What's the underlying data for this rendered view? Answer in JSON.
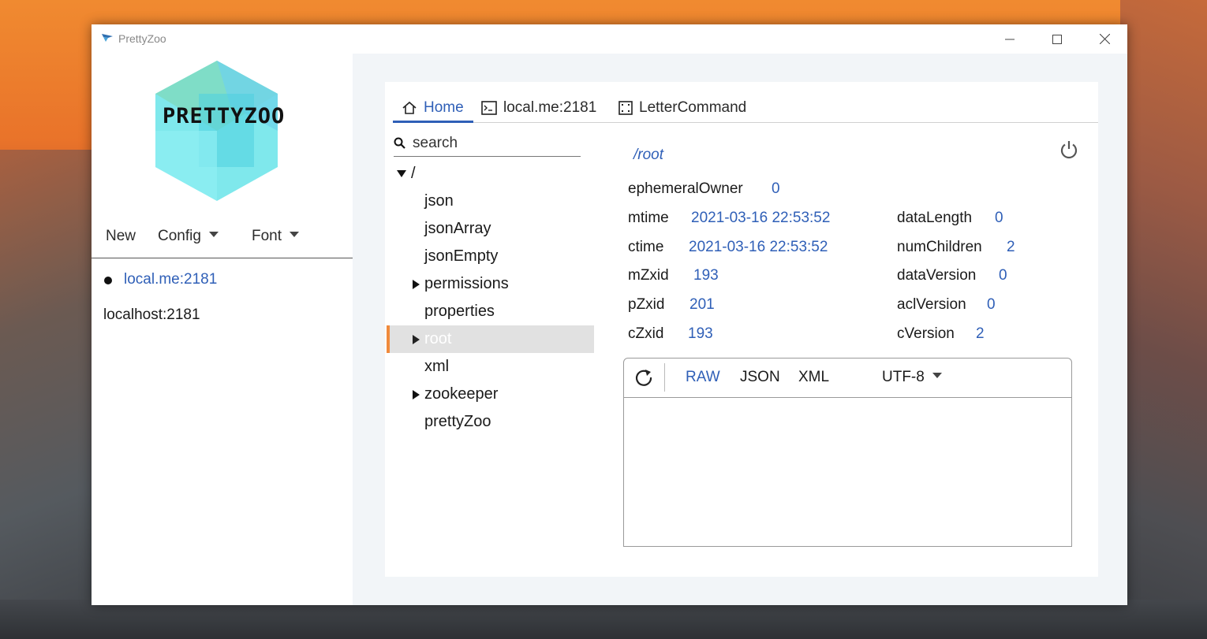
{
  "window": {
    "title": "PrettyZoo",
    "controls": {
      "minimize": "—",
      "maximize": "☐",
      "close": "✕"
    }
  },
  "sidebar": {
    "logo_text": "PRETTYZOO",
    "menu": [
      {
        "label": "New"
      },
      {
        "label": "Config"
      },
      {
        "label": "Font"
      }
    ],
    "servers": [
      {
        "label": "local.me:2181",
        "connected": true
      },
      {
        "label": "localhost:2181",
        "connected": false
      }
    ]
  },
  "tabs": [
    {
      "label": "Home",
      "icon": "home-icon",
      "active": true
    },
    {
      "label": "local.me:2181",
      "icon": "terminal-icon",
      "active": false
    },
    {
      "label": "LetterCommand",
      "icon": "grid-icon",
      "active": false
    }
  ],
  "search": {
    "placeholder": "search"
  },
  "tree": {
    "root_label": "/",
    "nodes": [
      {
        "label": "json",
        "expandable": false
      },
      {
        "label": "jsonArray",
        "expandable": false
      },
      {
        "label": "jsonEmpty",
        "expandable": false
      },
      {
        "label": "permissions",
        "expandable": true
      },
      {
        "label": "properties",
        "expandable": false
      },
      {
        "label": "root",
        "expandable": true,
        "selected": true
      },
      {
        "label": "xml",
        "expandable": false
      },
      {
        "label": "zookeeper",
        "expandable": true
      },
      {
        "label": "prettyZoo",
        "expandable": false
      }
    ]
  },
  "detail": {
    "path": "/root",
    "left_fields": [
      {
        "name": "ephemeralOwner",
        "value": "0"
      },
      {
        "name": "mtime",
        "value": "2021-03-16 22:53:52"
      },
      {
        "name": "ctime",
        "value": "2021-03-16 22:53:52"
      },
      {
        "name": "mZxid",
        "value": "193"
      },
      {
        "name": "pZxid",
        "value": "201"
      },
      {
        "name": "cZxid",
        "value": "193"
      }
    ],
    "right_fields": [
      {
        "name": "dataLength",
        "value": "0"
      },
      {
        "name": "numChildren",
        "value": "2"
      },
      {
        "name": "dataVersion",
        "value": "0"
      },
      {
        "name": "aclVersion",
        "value": "0"
      },
      {
        "name": "cVersion",
        "value": "2"
      }
    ]
  },
  "viewer": {
    "formats": [
      "RAW",
      "JSON",
      "XML"
    ],
    "active_format": "RAW",
    "encoding": "UTF-8",
    "content": ""
  },
  "colors": {
    "accent": "#2f5fb7",
    "selection_marker": "#f08a3c",
    "selection_bg": "#e1e1e1"
  }
}
